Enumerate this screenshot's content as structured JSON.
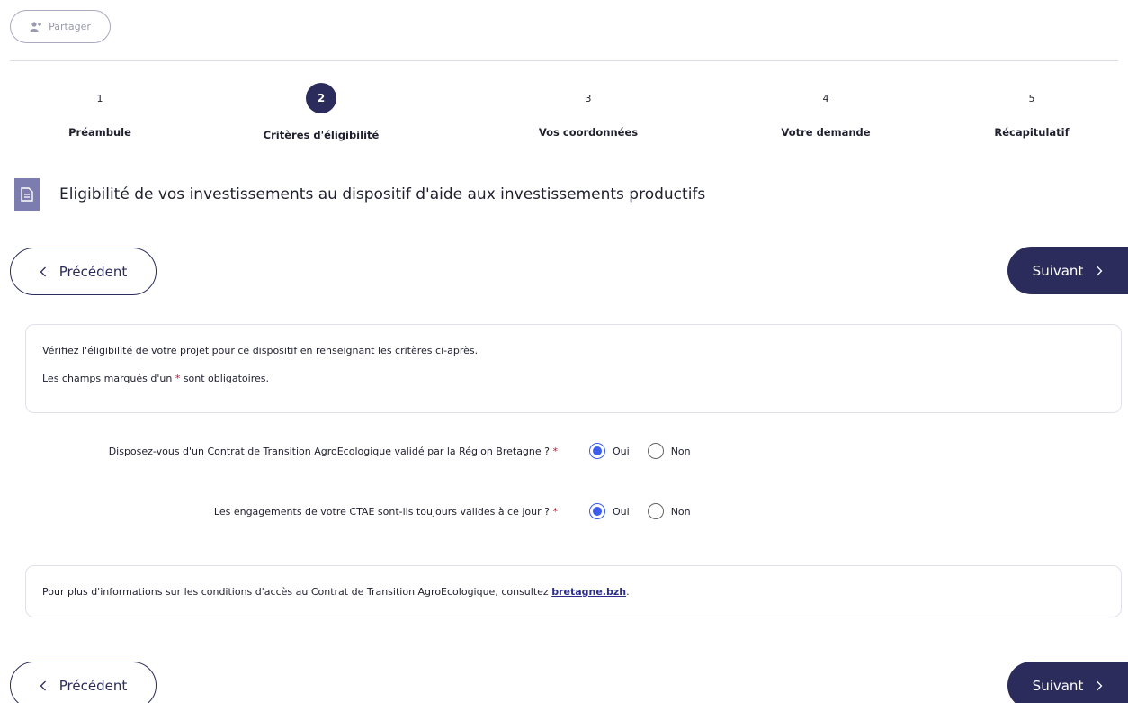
{
  "toolbar": {
    "share_label": "Partager"
  },
  "stepper": {
    "steps": [
      {
        "number": "1",
        "label": "Préambule"
      },
      {
        "number": "2",
        "label": "Critères d'éligibilité"
      },
      {
        "number": "3",
        "label": "Vos coordonnées"
      },
      {
        "number": "4",
        "label": "Votre demande"
      },
      {
        "number": "5",
        "label": "Récapitulatif"
      }
    ],
    "active_step": 2
  },
  "page": {
    "title": "Eligibilité de vos investissements au dispositif d'aide aux investissements productifs"
  },
  "nav": {
    "previous_label": "Précédent",
    "next_label": "Suivant"
  },
  "intro": {
    "line1": "Vérifiez l'éligibilité de votre projet pour ce dispositif en renseignant les critères ci-après.",
    "line2_before": "Les champs marqués d'un",
    "required_mark": "*",
    "line2_after": "sont obligatoires."
  },
  "questions": [
    {
      "text": "Disposez-vous d'un Contrat de Transition AgroEcologique validé par la Région Bretagne ?",
      "required_mark": "*",
      "options": [
        "Oui",
        "Non"
      ],
      "selected": "Oui"
    },
    {
      "text": "Les engagements de votre CTAE sont-ils toujours valides à ce jour ?",
      "required_mark": "*",
      "options": [
        "Oui",
        "Non"
      ],
      "selected": "Oui"
    }
  ],
  "more_info": {
    "text": "Pour plus d'informations sur les conditions d'accès au Contrat de Transition AgroEcologique, consultez",
    "link_label": "bretagne.bzh",
    "suffix": "."
  },
  "colors": {
    "primary": "#2b2c5b",
    "radio_selected": "#3d5eea",
    "required": "#c8102e",
    "icon_bg": "#7c7cb0"
  }
}
